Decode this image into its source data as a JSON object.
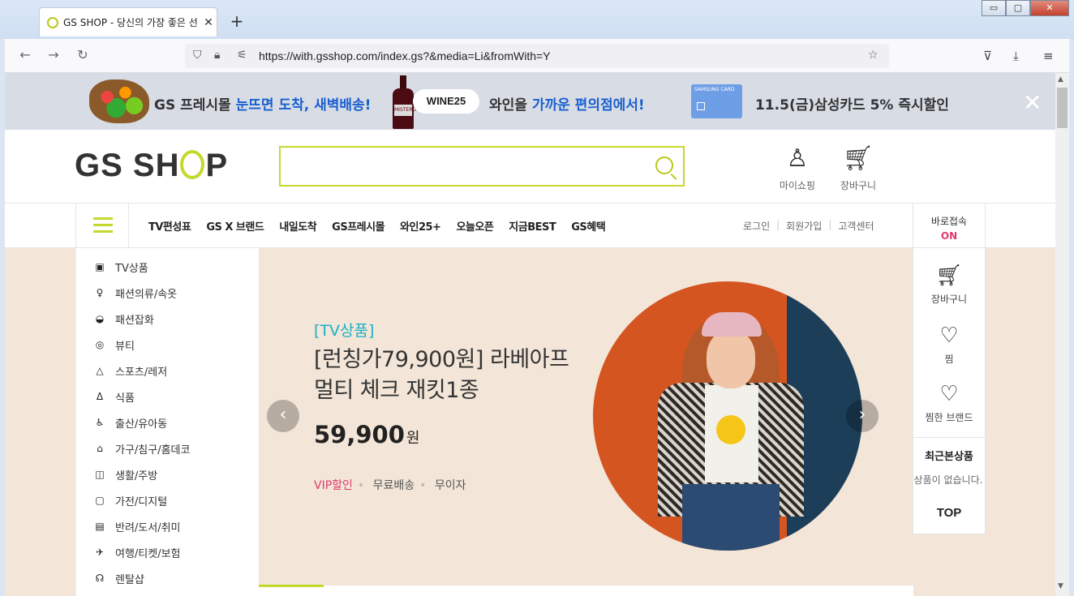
{
  "browser": {
    "tab_title": "GS SHOP - 당신의 가장 좋은 선",
    "tab_close": "✕",
    "new_tab": "+",
    "url": "https://with.gsshop.com/index.gs?&media=Li&fromWith=Y",
    "window_controls": {
      "minimize": "▭",
      "maximize": "▢",
      "close": "✕"
    }
  },
  "promo": {
    "fresh_prefix": "GS 프레시몰 ",
    "fresh_highlight": "눈뜨면 도착, 새벽배송!",
    "wine_badge": "WINE25",
    "wine_prefix": "와인을 ",
    "wine_highlight": "가까운 편의점에서!",
    "wine_label": "MISTERO",
    "card_label": "SAMSUNG CARD",
    "samsung_text": "11.5(금)삼성카드 5% 즉시할인",
    "close": "✕"
  },
  "header": {
    "logo_left": "GS SH",
    "logo_right": "P",
    "mypage": "마이쇼핑",
    "cart": "장바구니"
  },
  "gnb": {
    "items": [
      "TV편성표",
      "GS X 브랜드",
      "내일도착",
      "GS프레시몰",
      "와인25+",
      "오늘오픈",
      "지금BEST",
      "GS혜택"
    ],
    "login": "로그인",
    "signup": "회원가입",
    "support": "고객센터",
    "quick_label": "바로접속",
    "quick_status": "ON"
  },
  "categories": [
    {
      "label": "TV상품",
      "icon": "tv-icon"
    },
    {
      "label": "패션의류/속옷",
      "icon": "dress-icon"
    },
    {
      "label": "패션잡화",
      "icon": "bag-icon"
    },
    {
      "label": "뷰티",
      "icon": "beauty-icon"
    },
    {
      "label": "스포츠/레저",
      "icon": "tent-icon"
    },
    {
      "label": "식품",
      "icon": "apple-icon"
    },
    {
      "label": "출산/유아동",
      "icon": "stroller-icon"
    },
    {
      "label": "가구/침구/홈데코",
      "icon": "sofa-icon"
    },
    {
      "label": "생활/주방",
      "icon": "pot-icon"
    },
    {
      "label": "가전/디지털",
      "icon": "washer-icon"
    },
    {
      "label": "반려/도서/취미",
      "icon": "book-icon"
    },
    {
      "label": "여행/티켓/보험",
      "icon": "plane-icon"
    },
    {
      "label": "렌탈샵",
      "icon": "headset-icon"
    }
  ],
  "banner": {
    "tag": "[TV상품]",
    "title": "[런칭가79,900원] 라베아프 멀티 체크 재킷1종",
    "price": "59,900",
    "currency": "원",
    "flags": [
      "VIP할인",
      "무료배송",
      "무이자"
    ],
    "prev": "‹",
    "next": "›"
  },
  "right_panel": {
    "cart": "장바구니",
    "wish": "찜",
    "wish_brand": "찜한 브랜드",
    "recent_title": "최근본상품",
    "recent_empty": "상품이 없습니다.",
    "top": "TOP"
  },
  "colors": {
    "accent": "#c5d82c",
    "highlight_blue": "#1a5fd0",
    "vip_pink": "#e03a6b",
    "tag_teal": "#1ab0c4",
    "banner_bg": "#f3e6d8"
  }
}
